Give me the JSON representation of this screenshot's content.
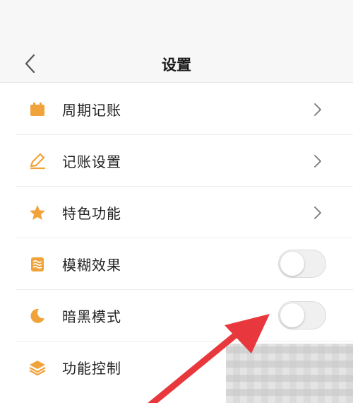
{
  "header": {
    "title": "设置"
  },
  "settings": {
    "items": [
      {
        "label": "周期记账",
        "icon": "calendar-icon",
        "control": "chevron"
      },
      {
        "label": "记账设置",
        "icon": "pen-icon",
        "control": "chevron"
      },
      {
        "label": "特色功能",
        "icon": "star-icon",
        "control": "chevron"
      },
      {
        "label": "模糊效果",
        "icon": "blur-icon",
        "control": "toggle",
        "toggle_on": false
      },
      {
        "label": "暗黑模式",
        "icon": "moon-icon",
        "control": "toggle",
        "toggle_on": false
      },
      {
        "label": "功能控制",
        "icon": "layers-icon",
        "control": "none"
      }
    ]
  },
  "colors": {
    "accent_icon": "#f0a33a",
    "annotation_arrow": "#e8383d"
  }
}
